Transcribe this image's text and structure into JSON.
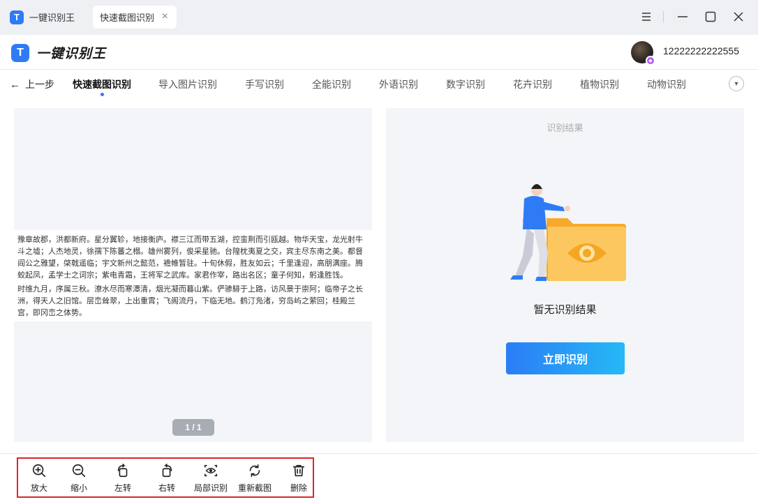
{
  "titlebar": {
    "app_tab_label": "一键识别王",
    "active_tab_label": "快速截图识别",
    "tab_close": "×"
  },
  "header": {
    "brand_name": "一键识别王",
    "username": "12222222222555"
  },
  "nav": {
    "back_label": "上一步",
    "items": [
      "快速截图识别",
      "导入图片识别",
      "手写识别",
      "全能识别",
      "外语识别",
      "数字识别",
      "花卉识别",
      "植物识别",
      "动物识别"
    ],
    "active_index": 0
  },
  "document": {
    "paragraph_1": "豫章故郡，洪都新府。星分翼轸，地接衡庐。襟三江而带五湖，控蛮荆而引瓯越。物华天宝，龙光射牛斗之墟；人杰地灵，徐孺下陈蕃之榻。雄州雾列，俊采星驰。台隍枕夷夏之交，宾主尽东南之美。都督阎公之雅望，棨戟遥临；宇文新州之懿范，襜帷暂驻。十旬休假，胜友如云；千里逢迎，高朋满座。腾蛟起凤，孟学士之词宗；紫电青霜，王将军之武库。家君作宰，路出名区；童子何知，躬逢胜饯。",
    "paragraph_2": "时维九月，序属三秋。潦水尽而寒潭清，烟光凝而暮山紫。俨骖騑于上路，访风景于崇阿；临帝子之长洲，得天人之旧馆。层峦耸翠，上出重霄；飞阁流丹，下临无地。鹤汀凫渚，穷岛屿之萦回；桂殿兰宫，即冈峦之体势。",
    "page_indicator": "1 / 1"
  },
  "result": {
    "title": "识别结果",
    "empty_text": "暂无识别结果",
    "recognize_button": "立即识别"
  },
  "toolbar": {
    "tools": [
      {
        "label": "放大",
        "icon": "zoom-in-icon"
      },
      {
        "label": "缩小",
        "icon": "zoom-out-icon"
      },
      {
        "label": "左转",
        "icon": "rotate-left-icon"
      },
      {
        "label": "右转",
        "icon": "rotate-right-icon"
      },
      {
        "label": "局部识别",
        "icon": "eye-scan-icon"
      },
      {
        "label": "重新截图",
        "icon": "refresh-icon"
      },
      {
        "label": "删除",
        "icon": "trash-icon"
      }
    ]
  },
  "colors": {
    "accent": "#2f7bf5",
    "button_gradient_start": "#2a7df6",
    "button_gradient_end": "#26b9f6",
    "toolbar_highlight": "#d9262c",
    "panel_bg": "#f3f5f8"
  }
}
